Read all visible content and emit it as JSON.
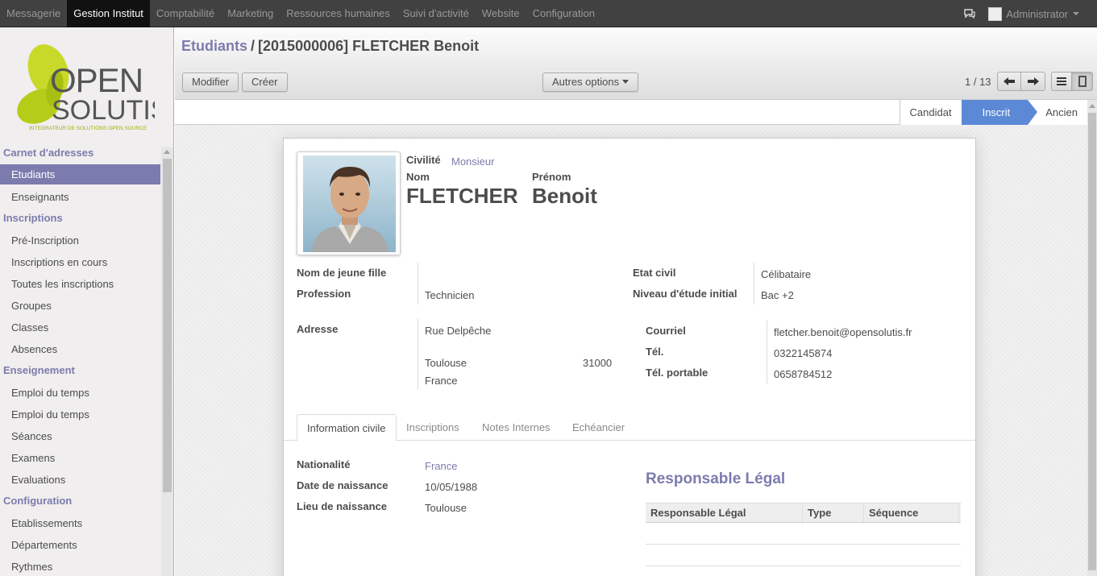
{
  "topbar": {
    "menu": [
      "Messagerie",
      "Gestion Institut",
      "Comptabilité",
      "Marketing",
      "Ressources humaines",
      "Suivi d'activité",
      "Website",
      "Configuration"
    ],
    "active_index": 1,
    "user": "Administrator"
  },
  "logo": {
    "line1": "OPEN",
    "line2": "SOLUTIS",
    "tagline": "INTEGRATEUR DE SOLUTIONS OPEN SOURCE"
  },
  "sidebar": {
    "sections": [
      {
        "title": "Carnet d'adresses",
        "items": [
          "Etudiants",
          "Enseignants"
        ]
      },
      {
        "title": "Inscriptions",
        "items": [
          "Pré-Inscription",
          "Inscriptions en cours",
          "Toutes les inscriptions",
          "Groupes",
          "Classes",
          "Absences"
        ]
      },
      {
        "title": "Enseignement",
        "items": [
          "Emploi du temps",
          "Emploi du temps",
          "Séances",
          "Examens",
          "Evaluations"
        ]
      },
      {
        "title": "Configuration",
        "items": [
          "Etablissements",
          "Départements",
          "Rythmes"
        ]
      }
    ],
    "active_item": "Etudiants"
  },
  "header": {
    "breadcrumb_parent": "Etudiants",
    "breadcrumb_separator": "/",
    "breadcrumb_current": "[2015000006] FLETCHER Benoit",
    "edit_label": "Modifier",
    "create_label": "Créer",
    "more_label": "Autres options",
    "pager": "1 / 13"
  },
  "status": {
    "steps": [
      "Candidat",
      "Inscrit",
      "Ancien"
    ],
    "active": "Inscrit"
  },
  "record": {
    "civilite_label": "Civilité",
    "civilite_value": "Monsieur",
    "nom_label": "Nom",
    "nom_value": "FLETCHER",
    "prenom_label": "Prénom",
    "prenom_value": "Benoit",
    "jeune_fille_label": "Nom de jeune fille",
    "jeune_fille_value": "",
    "profession_label": "Profession",
    "profession_value": "Technicien",
    "etat_civil_label": "Etat civil",
    "etat_civil_value": "Célibataire",
    "niveau_label": "Niveau d'étude initial",
    "niveau_value": "Bac +2",
    "adresse_label": "Adresse",
    "street": "Rue Delpêche",
    "city": "Toulouse",
    "zip": "31000",
    "country": "France",
    "courriel_label": "Courriel",
    "courriel_value": "fletcher.benoit@opensolutis.fr",
    "tel_label": "Tél.",
    "tel_value": "0322145874",
    "mobile_label": "Tél. portable",
    "mobile_value": "0658784512"
  },
  "tabs": [
    "Information civile",
    "Inscriptions",
    "Notes Internes",
    "Echéancier"
  ],
  "active_tab": "Information civile",
  "civil": {
    "nationalite_label": "Nationalité",
    "nationalite_value": "France",
    "naissance_label": "Date de naissance",
    "naissance_value": "10/05/1988",
    "lieu_label": "Lieu de naissance",
    "lieu_value": "Toulouse"
  },
  "responsable": {
    "title": "Responsable Légal",
    "columns": [
      "Responsable Légal",
      "Type",
      "Séquence"
    ]
  },
  "colors": {
    "accent": "#7c7bad",
    "status_active": "#5b89d6",
    "topbar": "#414141",
    "logo_green": "#b5cc18"
  }
}
